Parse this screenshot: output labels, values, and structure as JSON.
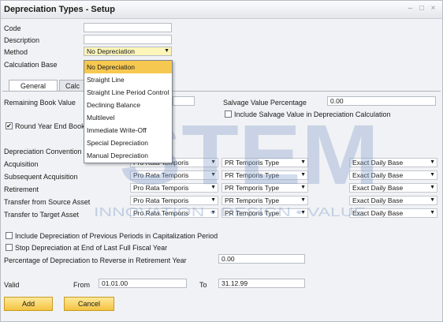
{
  "window": {
    "title": "Depreciation Types - Setup",
    "buttons": [
      "minimize-icon",
      "maximize-icon",
      "close-icon"
    ]
  },
  "form": {
    "code_label": "Code",
    "code_value": "",
    "description_label": "Description",
    "description_value": "",
    "method_label": "Method",
    "method_value": "No Depreciation",
    "calc_base_label": "Calculation Base"
  },
  "method_dropdown": {
    "options": [
      "No Depreciation",
      "Straight Line",
      "Straight Line Period Control",
      "Declining Balance",
      "Multilevel",
      "Immediate Write-Off",
      "Special Depreciation",
      "Manual Depreciation"
    ],
    "selected": "No Depreciation"
  },
  "tabs": [
    "General",
    "Calc"
  ],
  "general": {
    "remaining_book_value_label": "Remaining Book Value",
    "salvage_value_pct_label": "Salvage Value Percentage",
    "salvage_value_pct_value": "0.00",
    "include_salvage_label": "Include Salvage Value in Depreciation Calculation",
    "round_year_end_label": "Round Year End Book Val",
    "depreciation_convention_label": "Depreciation Convention"
  },
  "conventions": [
    {
      "label": "Acquisition",
      "col1": "Pro Rata Temporis",
      "col2": "PR Temporis Type",
      "col3": "Exact Daily Base"
    },
    {
      "label": "Subsequent Acquisition",
      "col1": "Pro Rata Temporis",
      "col2": "PR Temporis Type",
      "col3": "Exact Daily Base"
    },
    {
      "label": "Retirement",
      "col1": "Pro Rata Temporis",
      "col2": "PR Temporis Type",
      "col3": "Exact Daily Base"
    },
    {
      "label": "Transfer from Source Asset",
      "col1": "Pro Rata Temporis",
      "col2": "PR Temporis Type",
      "col3": "Exact Daily Base"
    },
    {
      "label": "Transfer to Target Asset",
      "col1": "Pro Rata Temporis",
      "col2": "PR Temporis Type",
      "col3": "Exact Daily Base"
    }
  ],
  "options": {
    "include_prev_periods_label": "Include Depreciation of Previous Periods in Capitalization Period",
    "stop_depr_label": "Stop Depreciation at End of Last Full Fiscal Year",
    "pct_reverse_label": "Percentage of Depreciation to Reverse in Retirement Year",
    "pct_reverse_value": "0.00"
  },
  "valid": {
    "label": "Valid",
    "from_label": "From",
    "from_value": "01.01.00",
    "to_label": "To",
    "to_value": "31.12.99"
  },
  "buttons": {
    "add": "Add",
    "cancel": "Cancel"
  },
  "watermark": {
    "big": "STEM",
    "tagline": "INNOVATION • DESIGN • VALUE"
  }
}
